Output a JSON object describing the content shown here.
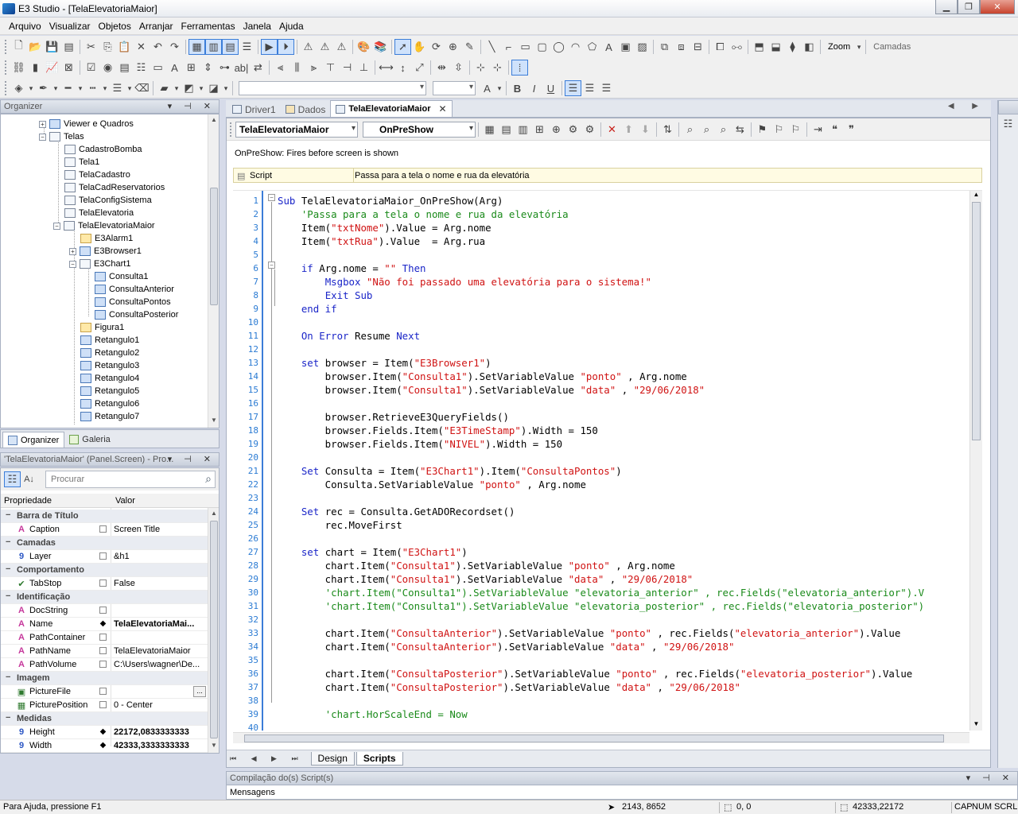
{
  "window": {
    "title": "E3 Studio - [TelaElevatoriaMaior]",
    "buttons": [
      "minimize-icon",
      "restore-icon",
      "close-icon"
    ]
  },
  "menu": [
    "Arquivo",
    "Visualizar",
    "Objetos",
    "Arranjar",
    "Ferramentas",
    "Janela",
    "Ajuda"
  ],
  "toolbar": {
    "zoom_label": "Zoom",
    "layers_label": "Camadas"
  },
  "organizer": {
    "title": "Organizer",
    "items": [
      {
        "label": "Viewer e Quadros"
      },
      {
        "label": "Telas"
      },
      {
        "label": "CadastroBomba"
      },
      {
        "label": "Tela1"
      },
      {
        "label": "TelaCadastro"
      },
      {
        "label": "TelaCadReservatorios"
      },
      {
        "label": "TelaConfigSistema"
      },
      {
        "label": "TelaElevatoria"
      },
      {
        "label": "TelaElevatoriaMaior"
      },
      {
        "label": "E3Alarm1"
      },
      {
        "label": "E3Browser1"
      },
      {
        "label": "E3Chart1"
      },
      {
        "label": "Consulta1"
      },
      {
        "label": "ConsultaAnterior"
      },
      {
        "label": "ConsultaPontos"
      },
      {
        "label": "ConsultaPosterior"
      },
      {
        "label": "Figura1"
      },
      {
        "label": "Retangulo1"
      },
      {
        "label": "Retangulo2"
      },
      {
        "label": "Retangulo3"
      },
      {
        "label": "Retangulo4"
      },
      {
        "label": "Retangulo5"
      },
      {
        "label": "Retangulo6"
      },
      {
        "label": "Retangulo7"
      }
    ],
    "tabs": [
      "Organizer",
      "Galeria"
    ]
  },
  "properties": {
    "title": "'TelaElevatoriaMaior' (Panel.Screen) - Pro...",
    "search_placeholder": "Procurar",
    "col_property": "Propriedade",
    "col_value": "Valor",
    "rows": [
      {
        "cat": true,
        "name": "Barra de Título"
      },
      {
        "name": "Caption",
        "icon": "A",
        "value": "Screen Title"
      },
      {
        "cat": true,
        "name": "Camadas"
      },
      {
        "name": "Layer",
        "icon": "9",
        "value": "&h1"
      },
      {
        "cat": true,
        "name": "Comportamento"
      },
      {
        "name": "TabStop",
        "icon": "✔",
        "value": "False"
      },
      {
        "cat": true,
        "name": "Identificação"
      },
      {
        "name": "DocString",
        "icon": "A",
        "value": ""
      },
      {
        "name": "Name",
        "icon": "A",
        "value": "TelaElevatoriaMai...",
        "bold": true,
        "diamond": true
      },
      {
        "name": "PathContainer",
        "icon": "A",
        "value": ""
      },
      {
        "name": "PathName",
        "icon": "A",
        "value": "TelaElevatoriaMaior"
      },
      {
        "name": "PathVolume",
        "icon": "A",
        "value": "C:\\Users\\wagner\\De..."
      },
      {
        "cat": true,
        "name": "Imagem"
      },
      {
        "name": "PictureFile",
        "icon": "▣",
        "value": "",
        "button": "..."
      },
      {
        "name": "PicturePosition",
        "icon": "▦",
        "value": "0 - Center"
      },
      {
        "cat": true,
        "name": "Medidas"
      },
      {
        "name": "Height",
        "icon": "9",
        "value": "22172,0833333333",
        "bold": true,
        "diamond": true
      },
      {
        "name": "Width",
        "icon": "9",
        "value": "42333,3333333333",
        "bold": true,
        "diamond": true
      }
    ]
  },
  "doc_tabs": [
    {
      "label": "Driver1"
    },
    {
      "label": "Dados"
    },
    {
      "label": "TelaElevatoriaMaior",
      "active": true
    }
  ],
  "script_editor": {
    "object_combo": "TelaElevatoriaMaior",
    "event_combo": "OnPreShow",
    "event_description": "OnPreShow: Fires before screen is shown",
    "script_label": "Script",
    "script_comment": "Passa para a tela o nome e rua da elevatória",
    "lines": [
      [
        [
          "kw",
          "Sub "
        ],
        [
          "",
          "TelaElevatoriaMaior_OnPreShow(Arg)"
        ]
      ],
      [
        [
          "",
          "    "
        ],
        [
          "com",
          "'Passa para a tela o nome e rua da elevatória"
        ]
      ],
      [
        [
          "",
          "    Item("
        ],
        [
          "str",
          "\"txtNome\""
        ],
        [
          "",
          ").Value = Arg.nome"
        ]
      ],
      [
        [
          "",
          "    Item("
        ],
        [
          "str",
          "\"txtRua\""
        ],
        [
          "",
          ").Value  = Arg.rua"
        ]
      ],
      [
        [
          "",
          ""
        ]
      ],
      [
        [
          "",
          "    "
        ],
        [
          "kw",
          "if "
        ],
        [
          "",
          "Arg.nome = "
        ],
        [
          "str",
          "\"\""
        ],
        [
          "kw",
          " Then"
        ]
      ],
      [
        [
          "",
          "        "
        ],
        [
          "kw",
          "Msgbox "
        ],
        [
          "str",
          "\"Não foi passado uma elevatória para o sistema!\""
        ]
      ],
      [
        [
          "",
          "        "
        ],
        [
          "kw",
          "Exit Sub"
        ]
      ],
      [
        [
          "",
          "    "
        ],
        [
          "kw",
          "end if"
        ]
      ],
      [
        [
          "",
          ""
        ]
      ],
      [
        [
          "",
          "    "
        ],
        [
          "kw",
          "On Error "
        ],
        [
          "",
          "Resume "
        ],
        [
          "kw",
          "Next"
        ]
      ],
      [
        [
          "",
          ""
        ]
      ],
      [
        [
          "",
          "    "
        ],
        [
          "kw",
          "set "
        ],
        [
          "",
          "browser = Item("
        ],
        [
          "str",
          "\"E3Browser1\""
        ],
        [
          "",
          ")"
        ]
      ],
      [
        [
          "",
          "        browser.Item("
        ],
        [
          "str",
          "\"Consulta1\""
        ],
        [
          "",
          ").SetVariableValue "
        ],
        [
          "str",
          "\"ponto\""
        ],
        [
          "",
          " , Arg.nome"
        ]
      ],
      [
        [
          "",
          "        browser.Item("
        ],
        [
          "str",
          "\"Consulta1\""
        ],
        [
          "",
          ").SetVariableValue "
        ],
        [
          "str",
          "\"data\""
        ],
        [
          "",
          " , "
        ],
        [
          "str",
          "\"29/06/2018\""
        ]
      ],
      [
        [
          "",
          ""
        ]
      ],
      [
        [
          "",
          "        browser.RetrieveE3QueryFields()"
        ]
      ],
      [
        [
          "",
          "        browser.Fields.Item("
        ],
        [
          "str",
          "\"E3TimeStamp\""
        ],
        [
          "",
          ").Width = 150"
        ]
      ],
      [
        [
          "",
          "        browser.Fields.Item("
        ],
        [
          "str",
          "\"NIVEL\""
        ],
        [
          "",
          ").Width = 150"
        ]
      ],
      [
        [
          "",
          ""
        ]
      ],
      [
        [
          "",
          "    "
        ],
        [
          "kw",
          "Set "
        ],
        [
          "",
          "Consulta = Item("
        ],
        [
          "str",
          "\"E3Chart1\""
        ],
        [
          "",
          ").Item("
        ],
        [
          "str",
          "\"ConsultaPontos\""
        ],
        [
          "",
          ")"
        ]
      ],
      [
        [
          "",
          "        Consulta.SetVariableValue "
        ],
        [
          "str",
          "\"ponto\""
        ],
        [
          "",
          " , Arg.nome"
        ]
      ],
      [
        [
          "",
          ""
        ]
      ],
      [
        [
          "",
          "    "
        ],
        [
          "kw",
          "Set "
        ],
        [
          "",
          "rec = Consulta.GetADORecordset()"
        ]
      ],
      [
        [
          "",
          "        rec.MoveFirst"
        ]
      ],
      [
        [
          "",
          ""
        ]
      ],
      [
        [
          "",
          "    "
        ],
        [
          "kw",
          "set "
        ],
        [
          "",
          "chart = Item("
        ],
        [
          "str",
          "\"E3Chart1\""
        ],
        [
          "",
          ")"
        ]
      ],
      [
        [
          "",
          "        chart.Item("
        ],
        [
          "str",
          "\"Consulta1\""
        ],
        [
          "",
          ").SetVariableValue "
        ],
        [
          "str",
          "\"ponto\""
        ],
        [
          "",
          " , Arg.nome"
        ]
      ],
      [
        [
          "",
          "        chart.Item("
        ],
        [
          "str",
          "\"Consulta1\""
        ],
        [
          "",
          ").SetVariableValue "
        ],
        [
          "str",
          "\"data\""
        ],
        [
          "",
          " , "
        ],
        [
          "str",
          "\"29/06/2018\""
        ]
      ],
      [
        [
          "",
          "        "
        ],
        [
          "com",
          "'chart.Item(\"Consulta1\").SetVariableValue \"elevatoria_anterior\" , rec.Fields(\"elevatoria_anterior\").V"
        ]
      ],
      [
        [
          "",
          "        "
        ],
        [
          "com",
          "'chart.Item(\"Consulta1\").SetVariableValue \"elevatoria_posterior\" , rec.Fields(\"elevatoria_posterior\")"
        ]
      ],
      [
        [
          "",
          ""
        ]
      ],
      [
        [
          "",
          "        chart.Item("
        ],
        [
          "str",
          "\"ConsultaAnterior\""
        ],
        [
          "",
          ").SetVariableValue "
        ],
        [
          "str",
          "\"ponto\""
        ],
        [
          "",
          " , rec.Fields("
        ],
        [
          "str",
          "\"elevatoria_anterior\""
        ],
        [
          "",
          ").Value"
        ]
      ],
      [
        [
          "",
          "        chart.Item("
        ],
        [
          "str",
          "\"ConsultaAnterior\""
        ],
        [
          "",
          ").SetVariableValue "
        ],
        [
          "str",
          "\"data\""
        ],
        [
          "",
          " , "
        ],
        [
          "str",
          "\"29/06/2018\""
        ]
      ],
      [
        [
          "",
          ""
        ]
      ],
      [
        [
          "",
          "        chart.Item("
        ],
        [
          "str",
          "\"ConsultaPosterior\""
        ],
        [
          "",
          ").SetVariableValue "
        ],
        [
          "str",
          "\"ponto\""
        ],
        [
          "",
          " , rec.Fields("
        ],
        [
          "str",
          "\"elevatoria_posterior\""
        ],
        [
          "",
          ").Value"
        ]
      ],
      [
        [
          "",
          "        chart.Item("
        ],
        [
          "str",
          "\"ConsultaPosterior\""
        ],
        [
          "",
          ").SetVariableValue "
        ],
        [
          "str",
          "\"data\""
        ],
        [
          "",
          " , "
        ],
        [
          "str",
          "\"29/06/2018\""
        ]
      ],
      [
        [
          "",
          ""
        ]
      ],
      [
        [
          "",
          "        "
        ],
        [
          "com",
          "'chart.HorScaleEnd = Now"
        ]
      ],
      [
        [
          "",
          ""
        ]
      ]
    ],
    "bottom_tabs": [
      "Design",
      "Scripts"
    ]
  },
  "compile_panel": {
    "title": "Compilação do(s) Script(s)",
    "messages_label": "Mensagens"
  },
  "statusbar": {
    "help": "Para Ajuda, pressione F1",
    "cursor_pos": "2143, 8652",
    "selection_pos": "0, 0",
    "size": "42333,22172",
    "cap": "CAP",
    "num": "NUM",
    "scrl": "SCRL"
  },
  "colors": {
    "keyword": "#1a25c8",
    "string": "#d01313",
    "comment": "#1a8a1a",
    "line_number": "#2b7bd3"
  }
}
